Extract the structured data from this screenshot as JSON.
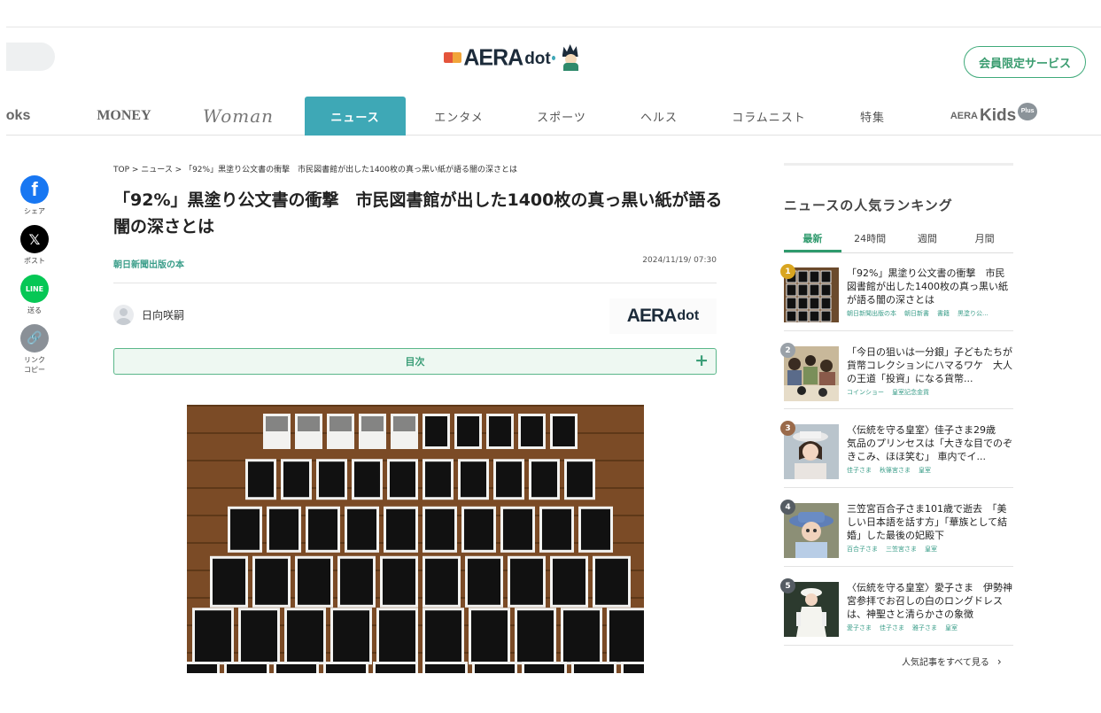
{
  "header": {
    "logo_text": "AERA",
    "logo_sub": "dot",
    "member_button": "会員限定サービス"
  },
  "nav": {
    "items": [
      {
        "label": "ooks"
      },
      {
        "label": "MONEY"
      },
      {
        "label": "Woman"
      },
      {
        "label": "ニュース"
      },
      {
        "label": "エンタメ"
      },
      {
        "label": "スポーツ"
      },
      {
        "label": "ヘルス"
      },
      {
        "label": "コラムニスト"
      },
      {
        "label": "特集"
      }
    ],
    "kids": {
      "a": "AERA",
      "k": "Kids",
      "plus": "Plus"
    }
  },
  "social": [
    {
      "icon": "facebook-icon",
      "glyph": "f",
      "label": "シェア"
    },
    {
      "icon": "x-icon",
      "glyph": "𝕏",
      "label": "ポスト"
    },
    {
      "icon": "line-icon",
      "glyph": "LINE",
      "label": "送る"
    },
    {
      "icon": "link-icon",
      "glyph": "🔗",
      "label1": "リンク",
      "label2": "コピー"
    }
  ],
  "article": {
    "breadcrumb": "TOP > ニュース > 「92%」黒塗り公文書の衝撃　市民図書館が出した1400枚の真っ黒い紙が語る闇の深さとは",
    "title": "「92%」黒塗り公文書の衝撃　市民図書館が出した1400枚の真っ黒い紙が語る闇の深さとは",
    "publisher": "朝日新聞出版の本",
    "date": "2024/11/19/ 07:30",
    "author": "日向咲嗣",
    "source_logo": "AERA",
    "source_logo_sub": "dot",
    "toc_label": "目次",
    "toc_plus": "+"
  },
  "sidebar": {
    "title": "ニュースの人気ランキング",
    "tabs": [
      "最新",
      "24時間",
      "週間",
      "月間"
    ],
    "rankings": [
      {
        "rank": "1",
        "title": "「92%」黒塗り公文書の衝撃　市民図書館が出した1400枚の真っ黒い紙が語る闇の深さとは",
        "tags": [
          "朝日新聞出版の本",
          "朝日新書",
          "書籍",
          "黒塗り公..."
        ]
      },
      {
        "rank": "2",
        "title": "「今日の狙いは一分銀」子どもたちが貨幣コレクションにハマるワケ　大人の王道「投資」になる貨幣...",
        "tags": [
          "コインショー",
          "皇室記念金貨"
        ]
      },
      {
        "rank": "3",
        "title": "〈伝統を守る皇室〉佳子さま29歳　気品のプリンセスは「大きな目でのぞきこみ、ほほ笑む」 車内でイ...",
        "tags": [
          "佳子さま",
          "秋篠宮さま",
          "皇室"
        ]
      },
      {
        "rank": "4",
        "title": "三笠宮百合子さま101歳で逝去　「美しい日本語を話す方」「華族として結婚」した最後の妃殿下",
        "tags": [
          "百合子さま",
          "三笠宮さま",
          "皇室"
        ]
      },
      {
        "rank": "5",
        "title": "〈伝統を守る皇室〉愛子さま　伊勢神宮参拝でお召しの白のロングドレスは、神聖さと清らかさの象徴",
        "tags": [
          "愛子さま",
          "佳子さま",
          "雅子さま",
          "皇室"
        ]
      }
    ],
    "more_link": "人気記事をすべて見る",
    "more_chevron": "›"
  },
  "colors": {
    "accent_teal": "#3ea8b6",
    "accent_green": "#3b9e78",
    "rank_gold": "#d9a520",
    "rank_silver": "#9aa1a8",
    "rank_bronze": "#9a6a4a",
    "rank_default": "#555c63"
  }
}
